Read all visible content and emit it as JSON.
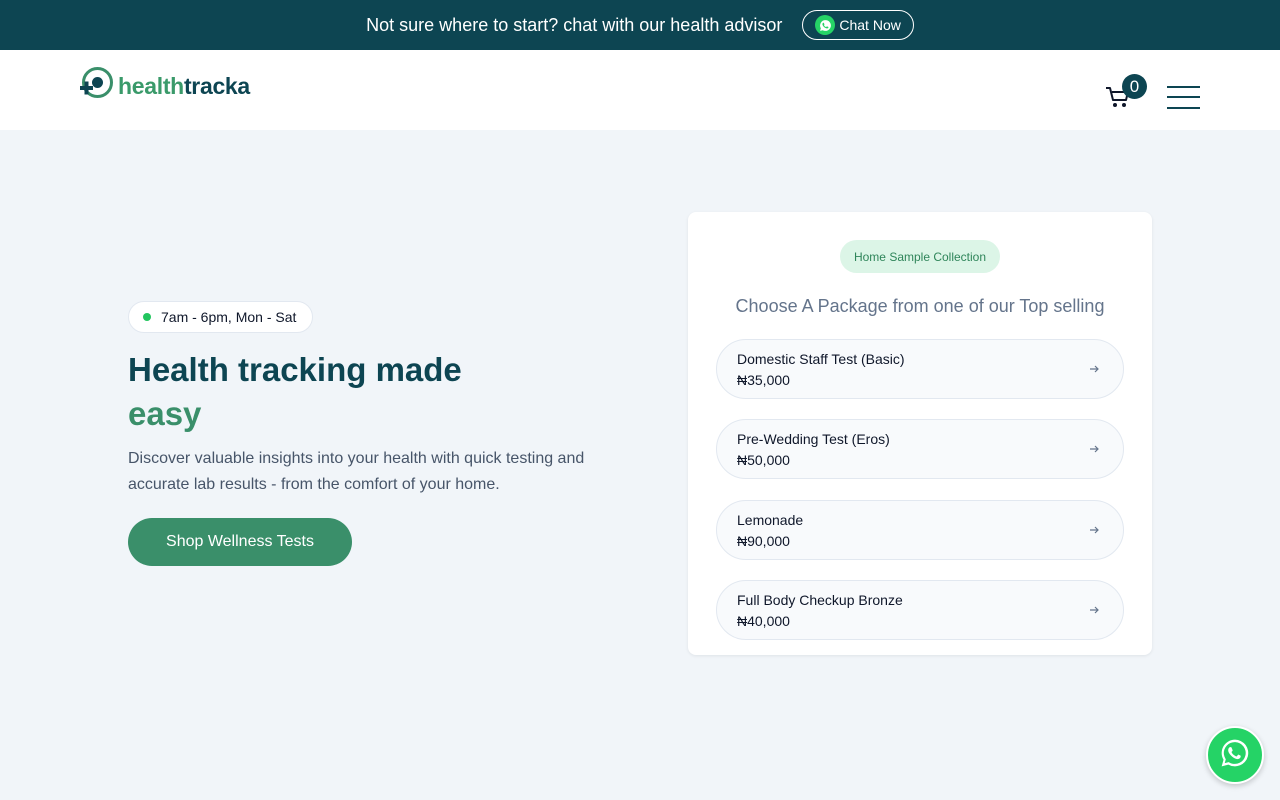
{
  "topbar": {
    "message": "Not sure where to start? chat with our health advisor",
    "chat_label": "Chat Now",
    "chat_icon": "whatsapp-icon"
  },
  "header": {
    "logo_text_1": "health",
    "logo_text_2": "tracka",
    "cart_count": "0",
    "cart_icon": "cart-icon",
    "menu_icon": "hamburger-menu-icon"
  },
  "hero": {
    "hours": "7am - 6pm, Mon - Sat",
    "title": "Health tracking made",
    "title_accent": "easy",
    "description": "Discover valuable insights into your health with quick testing and accurate lab results - from the comfort of your home.",
    "cta_label": "Shop Wellness Tests"
  },
  "packages_card": {
    "badge": "Home Sample Collection",
    "heading": "Choose A Package from one of our Top selling",
    "items": [
      {
        "name": "Domestic Staff Test (Basic)",
        "price": "₦35,000"
      },
      {
        "name": "Pre-Wedding Test (Eros)",
        "price": "₦50,000"
      },
      {
        "name": "Lemonade",
        "price": "₦90,000"
      },
      {
        "name": "Full Body Checkup Bronze",
        "price": "₦40,000"
      }
    ]
  },
  "floating": {
    "whatsapp_icon": "whatsapp-icon"
  },
  "colors": {
    "brand_dark": "#0d4552",
    "brand_green": "#3a8f6a",
    "whatsapp": "#25d366",
    "background": "#f1f5f9"
  }
}
